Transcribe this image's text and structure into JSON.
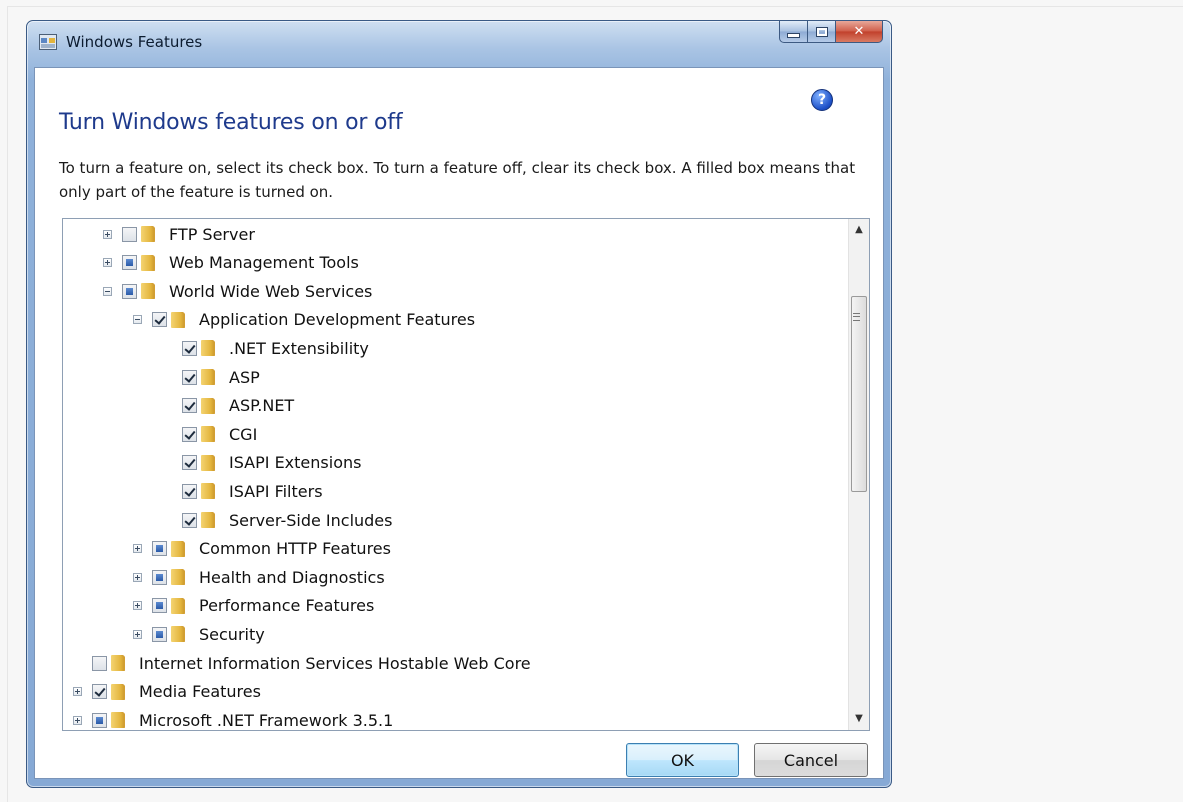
{
  "window": {
    "title": "Windows Features",
    "heading": "Turn Windows features on or off",
    "description": "To turn a feature on, select its check box. To turn a feature off, clear its check box. A filled box means that only part of the feature is turned on.",
    "help_icon": "?",
    "buttons": {
      "ok": "OK",
      "cancel": "Cancel"
    }
  },
  "features": [
    {
      "label": "FTP Server",
      "level": 1,
      "expander": "plus",
      "state": "unchecked",
      "icon": "folder-icon"
    },
    {
      "label": "Web Management Tools",
      "level": 1,
      "expander": "plus",
      "state": "partial",
      "icon": "folder-icon"
    },
    {
      "label": "World Wide Web Services",
      "level": 1,
      "expander": "minus",
      "state": "partial",
      "icon": "folder-icon"
    },
    {
      "label": "Application Development Features",
      "level": 2,
      "expander": "minus",
      "state": "checked",
      "icon": "folder-icon"
    },
    {
      "label": ".NET Extensibility",
      "level": 3,
      "expander": "none",
      "state": "checked",
      "icon": "folder-icon"
    },
    {
      "label": "ASP",
      "level": 3,
      "expander": "none",
      "state": "checked",
      "icon": "folder-icon"
    },
    {
      "label": "ASP.NET",
      "level": 3,
      "expander": "none",
      "state": "checked",
      "icon": "folder-icon"
    },
    {
      "label": "CGI",
      "level": 3,
      "expander": "none",
      "state": "checked",
      "icon": "folder-icon"
    },
    {
      "label": "ISAPI Extensions",
      "level": 3,
      "expander": "none",
      "state": "checked",
      "icon": "folder-icon"
    },
    {
      "label": "ISAPI Filters",
      "level": 3,
      "expander": "none",
      "state": "checked",
      "icon": "folder-icon"
    },
    {
      "label": "Server-Side Includes",
      "level": 3,
      "expander": "none",
      "state": "checked",
      "icon": "folder-icon"
    },
    {
      "label": "Common HTTP Features",
      "level": 2,
      "expander": "plus",
      "state": "partial",
      "icon": "folder-icon"
    },
    {
      "label": "Health and Diagnostics",
      "level": 2,
      "expander": "plus",
      "state": "partial",
      "icon": "folder-icon"
    },
    {
      "label": "Performance Features",
      "level": 2,
      "expander": "plus",
      "state": "partial",
      "icon": "folder-icon"
    },
    {
      "label": "Security",
      "level": 2,
      "expander": "plus",
      "state": "partial",
      "icon": "folder-icon"
    },
    {
      "label": "Internet Information Services Hostable Web Core",
      "level": 0,
      "expander": "none",
      "state": "unchecked",
      "icon": "folder-icon"
    },
    {
      "label": "Media Features",
      "level": 0,
      "expander": "plus",
      "state": "checked",
      "icon": "folder-icon"
    },
    {
      "label": "Microsoft .NET Framework 3.5.1",
      "level": 0,
      "expander": "plus",
      "state": "partial",
      "icon": "folder-icon"
    }
  ]
}
